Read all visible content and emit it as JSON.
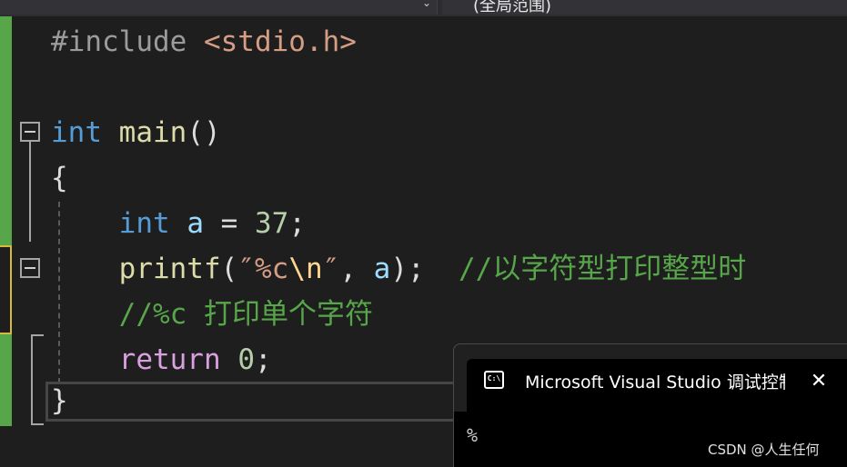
{
  "navbar": {
    "scope_chevron": "⌄",
    "member_scope": "(全局范围)"
  },
  "code": {
    "line1": {
      "directive": "#include",
      "header": "<stdio.h>"
    },
    "line3": {
      "kw_int": "int",
      "fn_name": "main",
      "parens": "()"
    },
    "line4": {
      "brace_open": "{"
    },
    "line5": {
      "kw_int": "int",
      "var": "a",
      "op": "=",
      "num": "37",
      "semi": ";"
    },
    "line6": {
      "fn": "printf",
      "open": "(",
      "str_open": "″%c",
      "esc": "\\n",
      "str_close": "″",
      "comma": ",",
      "arg": "a",
      "close": ");",
      "comment": "//以字符型打印整型时"
    },
    "line7": {
      "comment": "//%c 打印单个字符"
    },
    "line8": {
      "kw_return": "return",
      "num": "0",
      "semi": ";"
    },
    "line9": {
      "brace_close": "}"
    }
  },
  "console": {
    "icon_text": "C:\\",
    "title": "Microsoft Visual Studio 调试控制台",
    "close_symbol": "✕",
    "output": "%"
  },
  "watermark": "CSDN @人生任何",
  "colors": {
    "background": "#1e1e1e",
    "keyword": "#569cd6",
    "control_keyword": "#d8a0df",
    "function": "#dcdcaa",
    "variable": "#9cdcfe",
    "number": "#b5cea8",
    "string": "#d69d85",
    "comment": "#57a64a",
    "change_saved": "#57a64a",
    "change_unsaved": "#d7ba3c"
  }
}
